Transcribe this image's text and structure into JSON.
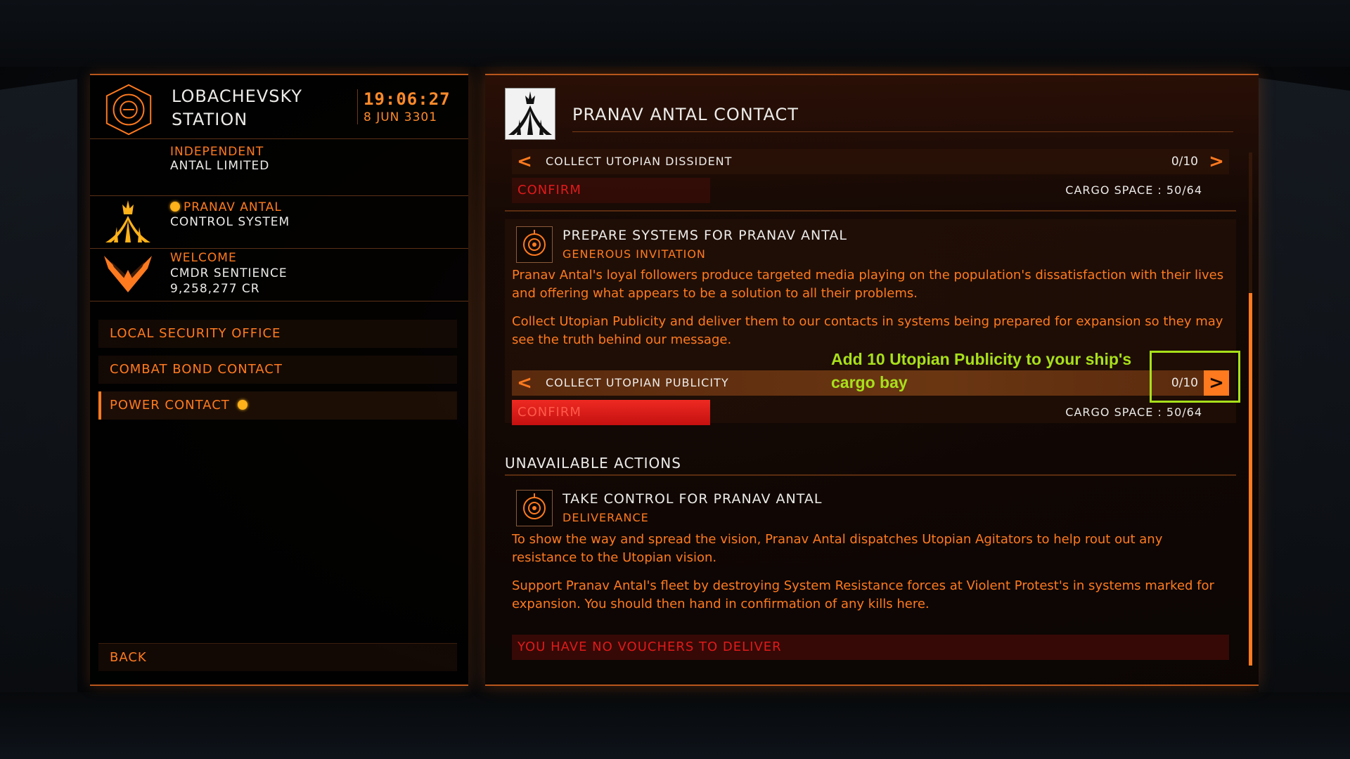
{
  "station": {
    "name": "LOBACHEVSKY STATION",
    "time": "19:06:27",
    "date": "8 JUN 3301",
    "allegiance": "INDEPENDENT",
    "faction": "ANTAL LIMITED"
  },
  "power": {
    "name": "PRANAV ANTAL",
    "status": "CONTROL SYSTEM"
  },
  "commander": {
    "greeting": "WELCOME",
    "name": "CMDR SENTIENCE",
    "credits": "9,258,277 CR"
  },
  "menu": {
    "items": [
      {
        "label": "LOCAL SECURITY OFFICE"
      },
      {
        "label": "COMBAT BOND CONTACT"
      },
      {
        "label": "POWER CONTACT"
      }
    ],
    "back_label": "BACK"
  },
  "contact": {
    "title": "PRANAV ANTAL CONTACT"
  },
  "actions": {
    "dissident": {
      "label": "COLLECT UTOPIAN DISSIDENT",
      "count": "0/10",
      "confirm": "CONFIRM",
      "cargo": "CARGO SPACE : 50/64"
    },
    "preparation": {
      "title": "PREPARE SYSTEMS FOR PRANAV ANTAL",
      "subtitle": "GENEROUS INVITATION",
      "desc1": "Pranav Antal's loyal followers produce targeted media playing on the population's dissatisfaction with their lives and offering what appears to be a solution to all their problems.",
      "desc2": "Collect Utopian Publicity and deliver them to our contacts in systems being prepared for expansion so they may see the truth behind our message.",
      "label": "COLLECT UTOPIAN PUBLICITY",
      "count": "0/10",
      "confirm": "CONFIRM",
      "cargo": "CARGO SPACE : 50/64"
    }
  },
  "unavailable": {
    "heading": "UNAVAILABLE ACTIONS",
    "title": "TAKE CONTROL FOR PRANAV ANTAL",
    "subtitle": "DELIVERANCE",
    "desc1": "To show the way and spread the vision, Pranav Antal dispatches Utopian Agitators to help rout out any resistance to the Utopian vision.",
    "desc2": "Support Pranav Antal's fleet by destroying System Resistance forces at Violent Protest's in systems marked for expansion. You should then hand in confirmation of any kills here.",
    "notice": "YOU HAVE NO VOUCHERS TO DELIVER"
  },
  "annotation": {
    "text": "Add 10 Utopian Publicity to your ship's cargo bay"
  },
  "icons": {
    "station": "station-emblem-icon",
    "power": "pranav-antal-power-icon",
    "rank": "rank-wings-icon",
    "mission": "mission-target-icon",
    "prev": "chevron-left-icon",
    "next": "chevron-right-icon",
    "power_marker": "sun-marker-icon"
  },
  "colors": {
    "accent": "#ff7a1f",
    "alert": "#e01a1a",
    "annotation": "#a8e01a",
    "power_yellow": "#ffb21a"
  }
}
